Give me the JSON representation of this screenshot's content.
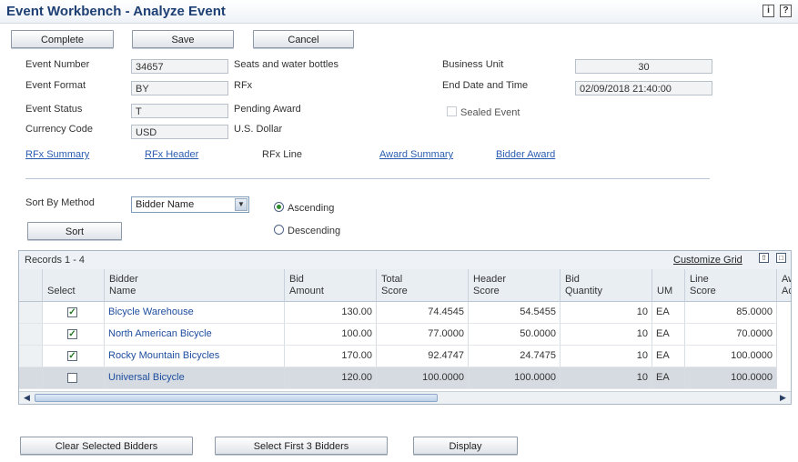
{
  "window": {
    "title": "Event Workbench - Analyze Event",
    "info_glyph": "i",
    "help_glyph": "?"
  },
  "toolbar": {
    "complete": "Complete",
    "save": "Save",
    "cancel": "Cancel"
  },
  "event": {
    "number_label": "Event Number",
    "number": "34657",
    "description": "Seats and water bottles",
    "format_label": "Event Format",
    "format": "BY",
    "format_desc": "RFx",
    "status_label": "Event Status",
    "status": "T",
    "status_desc": "Pending Award",
    "currency_label": "Currency Code",
    "currency": "USD",
    "currency_desc": "U.S. Dollar",
    "bu_label": "Business Unit",
    "bu": "30",
    "end_label": "End Date and Time",
    "end": "02/09/2018 21:40:00",
    "sealed_label": "Sealed Event"
  },
  "links": {
    "rfx_summary": "RFx Summary",
    "rfx_header": "RFx Header",
    "rfx_line": "RFx Line",
    "award_summary": "Award Summary",
    "bidder_award": "Bidder Award"
  },
  "sort": {
    "label": "Sort By Method",
    "selected": "Bidder Name",
    "button": "Sort",
    "ascending": "Ascending",
    "descending": "Descending",
    "selected_order": "ascending"
  },
  "grid": {
    "records": "Records 1 - 4",
    "customize": "Customize Grid",
    "columns": [
      {
        "l1": "",
        "l2": "Select"
      },
      {
        "l1": "Bidder",
        "l2": "Name"
      },
      {
        "l1": "Bid",
        "l2": "Amount"
      },
      {
        "l1": "Total",
        "l2": "Score"
      },
      {
        "l1": "Header",
        "l2": "Score"
      },
      {
        "l1": "Bid",
        "l2": "Quantity"
      },
      {
        "l1": "",
        "l2": "UM"
      },
      {
        "l1": "Line",
        "l2": "Score"
      },
      {
        "l1": "Aw",
        "l2": "Ac"
      }
    ],
    "rows": [
      {
        "selected": true,
        "bidder": "Bicycle Warehouse",
        "bid": "130.00",
        "total": "74.4545",
        "header": "54.5455",
        "qty": "10",
        "um": "EA",
        "line": "85.0000"
      },
      {
        "selected": true,
        "bidder": "North American Bicycle",
        "bid": "100.00",
        "total": "77.0000",
        "header": "50.0000",
        "qty": "10",
        "um": "EA",
        "line": "70.0000"
      },
      {
        "selected": true,
        "bidder": "Rocky Mountain Bicycles",
        "bid": "170.00",
        "total": "92.4747",
        "header": "24.7475",
        "qty": "10",
        "um": "EA",
        "line": "100.0000"
      },
      {
        "selected": false,
        "bidder": "Universal Bicycle",
        "bid": "120.00",
        "total": "100.0000",
        "header": "100.0000",
        "qty": "10",
        "um": "EA",
        "line": "100.0000"
      }
    ]
  },
  "footer": {
    "clear": "Clear Selected Bidders",
    "select3": "Select First 3 Bidders",
    "display": "Display"
  }
}
